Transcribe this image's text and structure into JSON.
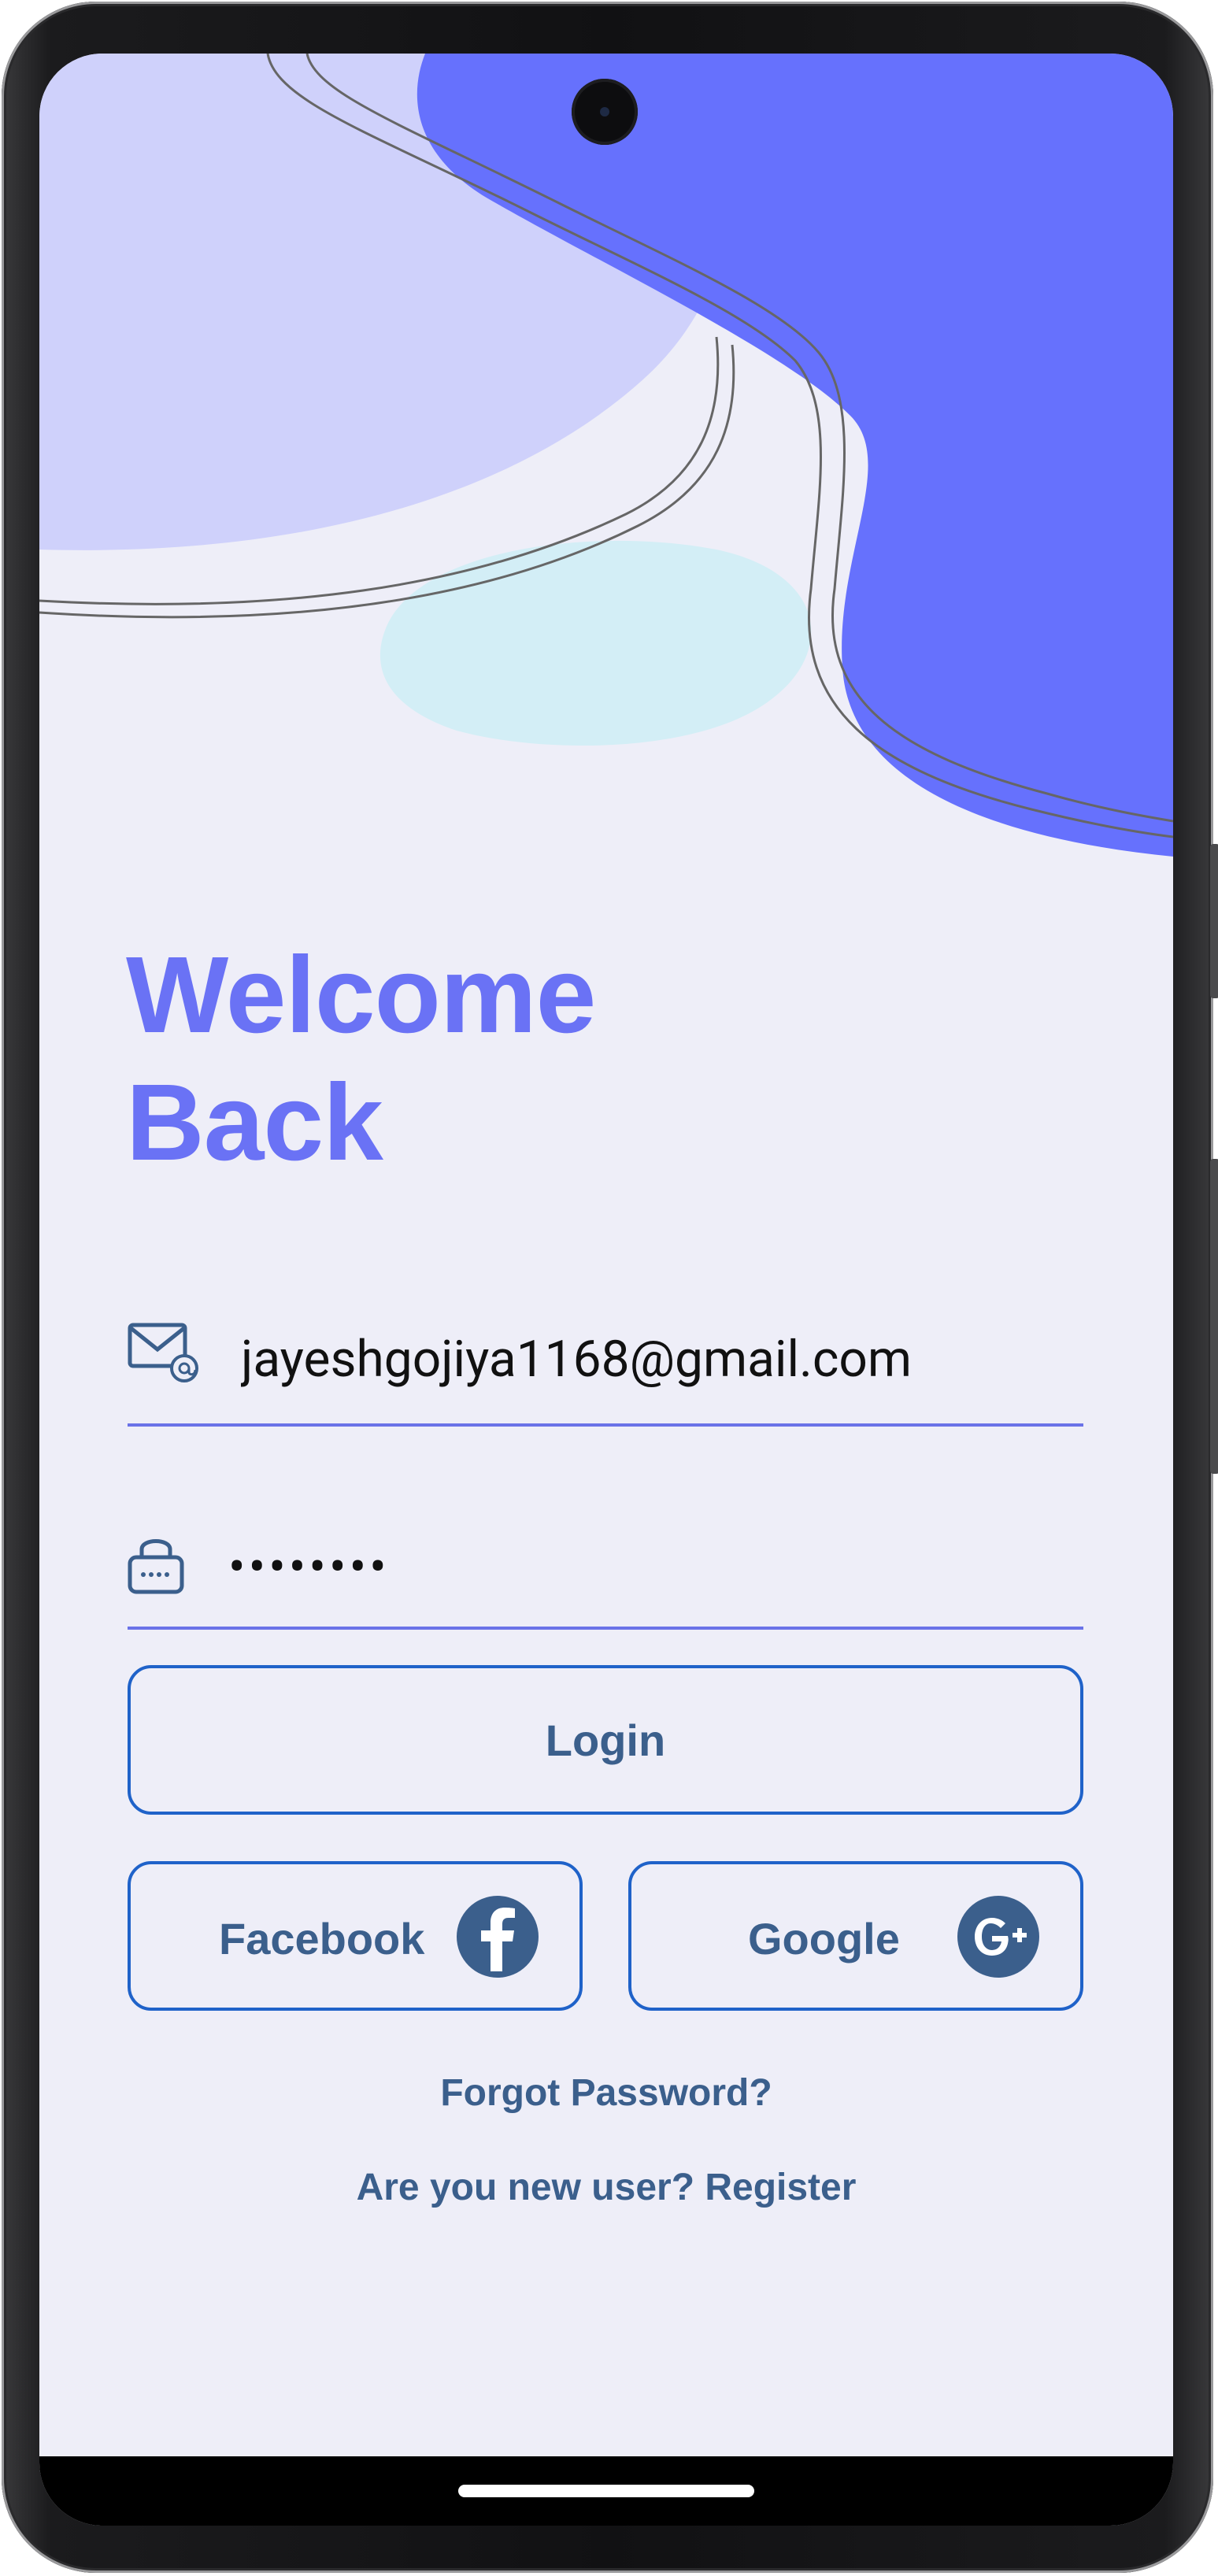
{
  "screen": {
    "title_line1": "Welcome",
    "title_line2": "Back"
  },
  "email": {
    "icon": "mail-at-icon",
    "value": "jayeshgojiya1168@gmail.com"
  },
  "password": {
    "icon": "lock-icon",
    "value": "••••••••"
  },
  "buttons": {
    "login_label": "Login",
    "facebook_label": "Facebook",
    "google_label": "Google"
  },
  "links": {
    "forgot": "Forgot Password?",
    "register": "Are you new user? Register"
  },
  "colors": {
    "accent": "#6a72f5",
    "primary_text": "#3b5f8c",
    "border": "#1f62c9",
    "background": "#eeeef8",
    "blob_light": "#cfd1fb",
    "blob_dark": "#6671fd",
    "blob_cyan": "#d3eef6"
  }
}
